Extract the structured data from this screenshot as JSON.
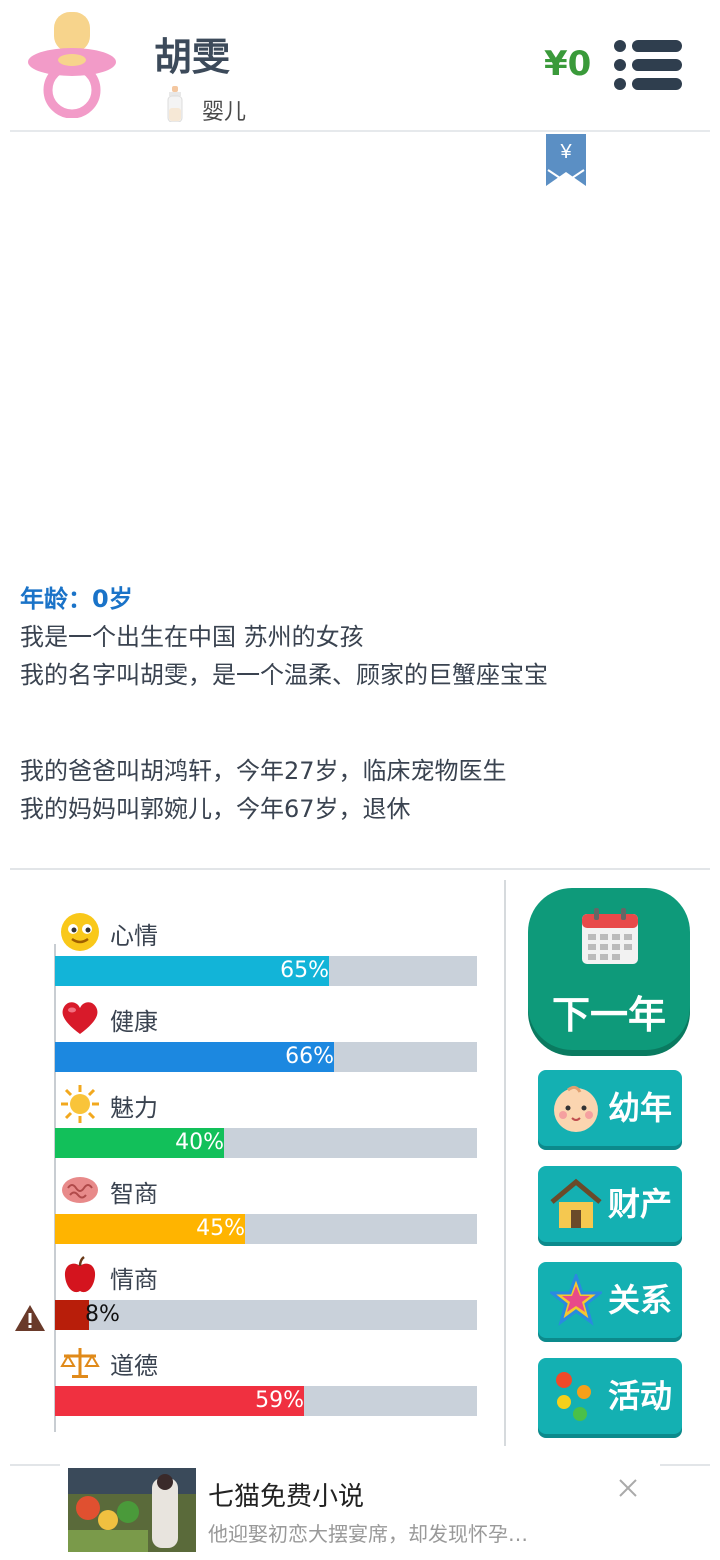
{
  "header": {
    "name": "胡雯",
    "stage": "婴儿",
    "money": "¥0"
  },
  "bookmark": {
    "symbol": "¥"
  },
  "story": {
    "age_label": "年龄：0岁",
    "lines": [
      "我是一个出生在中国 苏州的女孩",
      "我的名字叫胡雯，是一个温柔、顾家的巨蟹座宝宝",
      "我的爸爸叫胡鸿轩，今年27岁，临床宠物医生",
      "我的妈妈叫郭婉儿，今年67岁，退休"
    ]
  },
  "stats": [
    {
      "label": "心情",
      "value": 65,
      "text": "65%",
      "color": "#12b4d8",
      "icon": "smiley-icon"
    },
    {
      "label": "健康",
      "value": 66,
      "text": "66%",
      "color": "#1c88e0",
      "icon": "heart-icon"
    },
    {
      "label": "魅力",
      "value": 40,
      "text": "40%",
      "color": "#12c05a",
      "icon": "sun-icon"
    },
    {
      "label": "智商",
      "value": 45,
      "text": "45%",
      "color": "#ffb400",
      "icon": "brain-icon"
    },
    {
      "label": "情商",
      "value": 8,
      "text": "8%",
      "color": "#b81e0a",
      "icon": "apple-icon",
      "warning": true
    },
    {
      "label": "道德",
      "value": 59,
      "text": "59%",
      "color": "#f03040",
      "icon": "scales-icon"
    }
  ],
  "buttons": {
    "next_year": "下一年",
    "childhood": "幼年",
    "property": "财产",
    "relations": "关系",
    "activities": "活动"
  },
  "ad": {
    "title": "七猫免费小说",
    "desc": "他迎娶初恋大摆宴席，却发现怀孕…"
  }
}
